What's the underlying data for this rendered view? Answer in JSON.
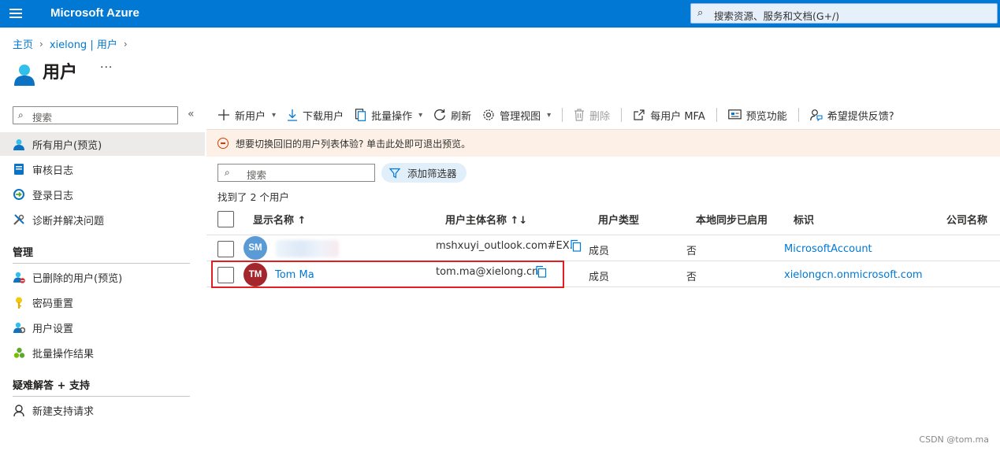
{
  "topbar": {
    "brand": "Microsoft Azure",
    "search_placeholder": "搜索资源、服务和文档(G+/)"
  },
  "breadcrumb": [
    "主页",
    "xielong | 用户"
  ],
  "page": {
    "title": "用户",
    "more": "···"
  },
  "sidebar": {
    "search_placeholder": "搜索",
    "collapse": "«",
    "items": [
      {
        "label": "所有用户(预览)",
        "icon": "user-icon",
        "active": true
      },
      {
        "label": "审核日志",
        "icon": "audit-log-icon"
      },
      {
        "label": "登录日志",
        "icon": "sign-in-log-icon"
      },
      {
        "label": "诊断并解决问题",
        "icon": "wrench-icon"
      }
    ],
    "sections": [
      {
        "title": "管理",
        "items": [
          {
            "label": "已删除的用户(预览)",
            "icon": "deleted-user-icon"
          },
          {
            "label": "密码重置",
            "icon": "key-icon"
          },
          {
            "label": "用户设置",
            "icon": "user-settings-icon"
          },
          {
            "label": "批量操作结果",
            "icon": "bulk-results-icon"
          }
        ]
      },
      {
        "title": "疑难解答 + 支持",
        "items": [
          {
            "label": "新建支持请求",
            "icon": "support-icon"
          }
        ]
      }
    ]
  },
  "toolbar": {
    "new_user": "新用户",
    "download_users": "下载用户",
    "bulk_operations": "批量操作",
    "refresh": "刷新",
    "manage_view": "管理视图",
    "delete": "删除",
    "per_user_mfa": "每用户 MFA",
    "preview_features": "预览功能",
    "feedback": "希望提供反馈?"
  },
  "banner": {
    "text": "想要切换回旧的用户列表体验? 单击此处即可退出预览。"
  },
  "filter": {
    "search_placeholder": "搜索",
    "add_filter": "添加筛选器",
    "found_text": "找到了 2 个用户"
  },
  "table": {
    "columns": {
      "display_name": "显示名称 ↑",
      "upn": "用户主体名称 ↑↓",
      "user_type": "用户类型",
      "on_prem_sync": "本地同步已启用",
      "identities": "标识",
      "company": "公司名称"
    },
    "rows": [
      {
        "initials": "SM",
        "avatar_color": "#5b9bd5",
        "display_name": "",
        "upn": "mshxuyi_outlook.com#EX...",
        "user_type": "成员",
        "on_prem_sync": "否",
        "identities": "MicrosoftAccount"
      },
      {
        "initials": "TM",
        "avatar_color": "#a4262c",
        "display_name": "Tom Ma",
        "upn": "tom.ma@xielong.cn",
        "user_type": "成员",
        "on_prem_sync": "否",
        "identities": "xielongcn.onmicrosoft.com"
      }
    ]
  },
  "watermark": "CSDN @tom.ma"
}
